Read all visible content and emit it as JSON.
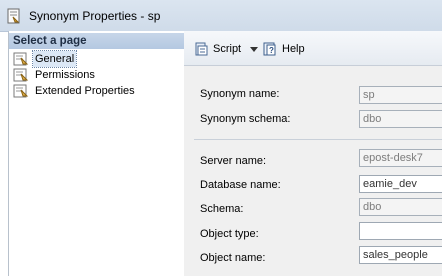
{
  "window": {
    "title": "Synonym Properties - sp"
  },
  "left_pane": {
    "header": "Select a page",
    "items": [
      {
        "label": "General",
        "icon": "page-properties-icon",
        "selected": true
      },
      {
        "label": "Permissions",
        "icon": "page-properties-icon",
        "selected": false
      },
      {
        "label": "Extended Properties",
        "icon": "page-properties-icon",
        "selected": false
      }
    ]
  },
  "toolbar": {
    "script_label": "Script",
    "help_label": "Help"
  },
  "form": {
    "synonym_name": {
      "label": "Synonym name:",
      "value": "sp"
    },
    "synonym_schema": {
      "label": "Synonym schema:",
      "value": "dbo"
    },
    "server_name": {
      "label": "Server name:",
      "value": "epost-desk7"
    },
    "database_name": {
      "label": "Database name:",
      "value": "eamie_dev"
    },
    "schema": {
      "label": "Schema:",
      "value": "dbo"
    },
    "object_type": {
      "label": "Object type:",
      "value": ""
    },
    "object_name": {
      "label": "Object name:",
      "value": "sales_people"
    }
  },
  "colors": {
    "titlebar": "#d5e1ee",
    "page_header": "#bccde4",
    "right_pane_bg": "#f0f0f0"
  }
}
